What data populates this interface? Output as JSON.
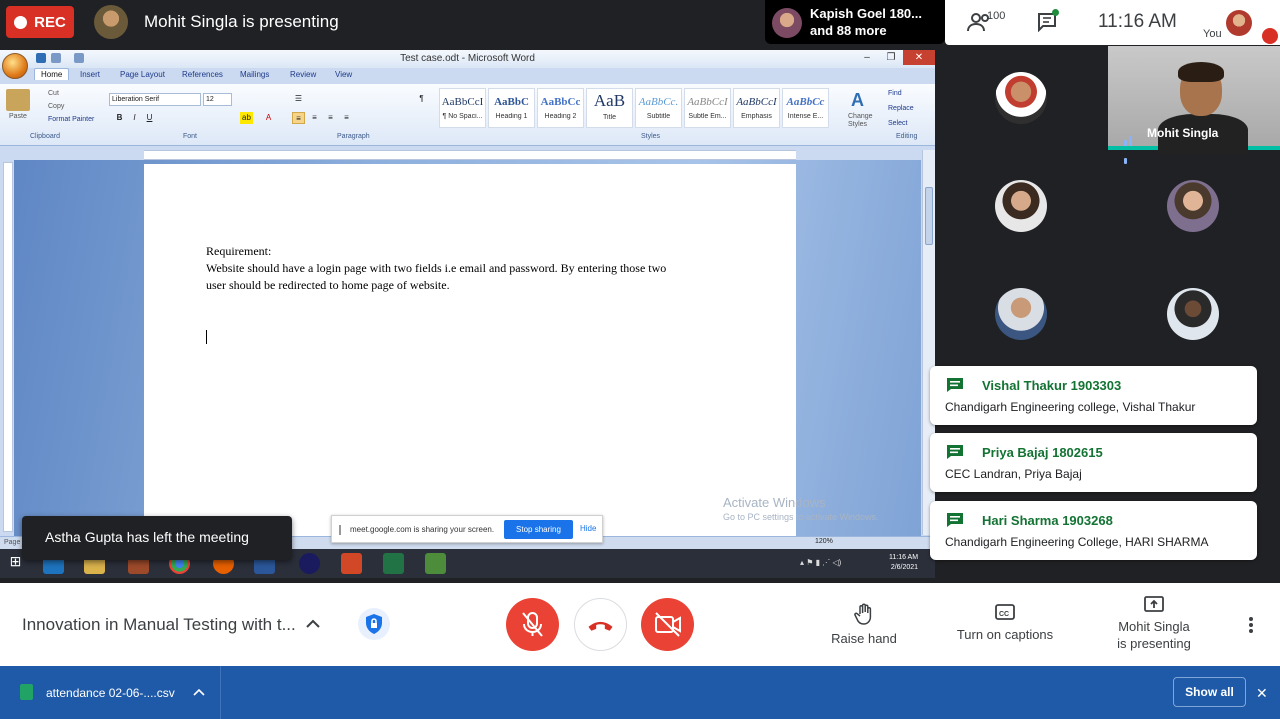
{
  "top_bar": {
    "rec_label": "REC",
    "presenting_title": "Mohit Singla is presenting",
    "viewer_name": "Kapish Goel 180...",
    "viewer_more": "and 88 more",
    "participant_count": "100",
    "clock": "11:16  AM",
    "you_label": "You"
  },
  "word": {
    "title": "Test case.odt - Microsoft Word",
    "tabs": [
      "Home",
      "Insert",
      "Page Layout",
      "References",
      "Mailings",
      "Review",
      "View"
    ],
    "clipboard": {
      "paste": "Paste",
      "cut": "Cut",
      "copy": "Copy",
      "format_painter": "Format Painter"
    },
    "font_name": "Liberation Serif",
    "font_size": "12",
    "groups": {
      "clipboard": "Clipboard",
      "font": "Font",
      "paragraph": "Paragraph",
      "styles": "Styles",
      "editing": "Editing"
    },
    "styles": [
      {
        "sample": "AaBbCcI",
        "name": "¶ No Spaci..."
      },
      {
        "sample": "AaBbC",
        "name": "Heading 1"
      },
      {
        "sample": "AaBbCc",
        "name": "Heading 2"
      },
      {
        "sample": "AaB",
        "name": "Title"
      },
      {
        "sample": "AaBbCc.",
        "name": "Subtitle"
      },
      {
        "sample": "AaBbCcI",
        "name": "Subtle Em..."
      },
      {
        "sample": "AaBbCcI",
        "name": "Emphasis"
      },
      {
        "sample": "AaBbCc",
        "name": "Intense E..."
      }
    ],
    "change_styles": "Change Styles",
    "editing": {
      "find": "Find",
      "replace": "Replace",
      "select": "Select"
    },
    "document": {
      "heading": "Requirement:",
      "line1": "Website should have a login page with two fields i.e email and password. By entering those two",
      "line2": "user should be redirected to home page of website."
    },
    "status_page": "Page",
    "zoom": "120%",
    "activate_windows": "Activate Windows",
    "activate_windows_sub": "Go to PC settings to activate Windows.",
    "taskbar_time": "11:16 AM",
    "taskbar_date": "2/6/2021"
  },
  "share_bar": {
    "message": "meet.google.com is sharing your screen.",
    "stop_label": "Stop sharing",
    "hide_label": "Hide"
  },
  "toast": {
    "text": "Astha Gupta has left the meeting"
  },
  "presenter_tile": {
    "name": "Mohit Singla"
  },
  "chat_messages": [
    {
      "sender": "Vishal Thakur 1903303",
      "text": "Chandigarh Engineering college, Vishal Thakur"
    },
    {
      "sender": "Priya Bajaj 1802615",
      "text": "CEC Landran, Priya Bajaj"
    },
    {
      "sender": "Hari Sharma 1903268",
      "text": "Chandigarh Engineering College,  HARI SHARMA"
    }
  ],
  "bottom_bar": {
    "meeting_title": "Innovation in Manual Testing with t...",
    "raise_hand": "Raise hand",
    "captions": "Turn on captions",
    "presenting_line1": "Mohit Singla",
    "presenting_line2": "is presenting"
  },
  "download_bar": {
    "file_name": "attendance 02-06-....csv",
    "show_all": "Show all"
  },
  "colors": {
    "record_red": "#d93025",
    "meet_red": "#ea4335",
    "chat_green": "#137333",
    "download_blue": "#1f5aa8",
    "accent_teal": "#00bfa5"
  }
}
